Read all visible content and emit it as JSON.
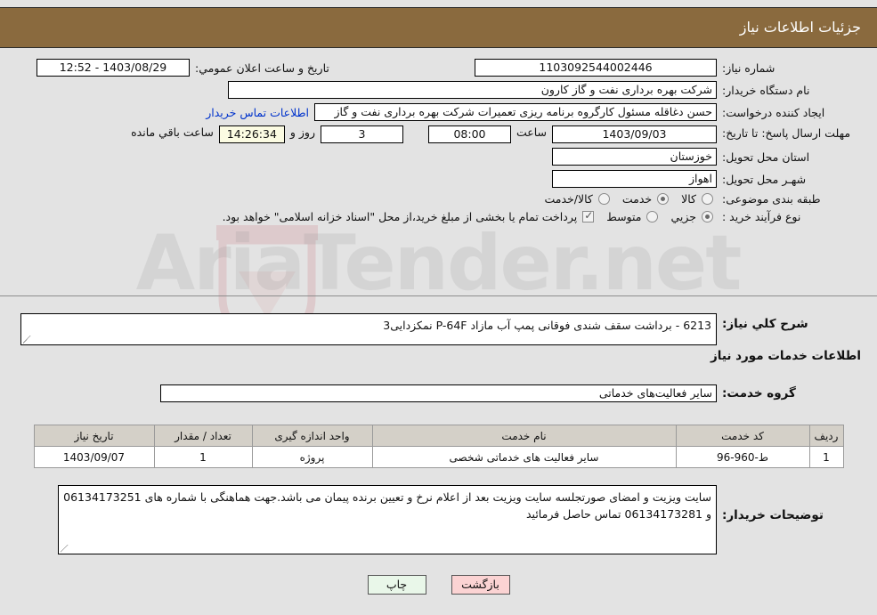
{
  "header": {
    "title": "جزئیات اطلاعات نیاز"
  },
  "form": {
    "need_number_label": "شماره نیاز:",
    "need_number_value": "1103092544002446",
    "announce_datetime_label": "تاریخ و ساعت اعلان عمومي:",
    "announce_datetime_value": "1403/08/29 - 12:52",
    "buyer_org_label": "نام دستگاه خریدار:",
    "buyer_org_value": "شرکت بهره برداری نفت و گاز کارون",
    "requester_label": "ایجاد کننده درخواست:",
    "requester_value": "حسن دغاقله مسئول کارگروه برنامه ریزی تعمیرات شرکت بهره برداری نفت و گاز",
    "contact_link": "اطلاعات تماس خریدار",
    "deadline_label": "مهلت ارسال پاسخ: تا تاریخ:",
    "deadline_date": "1403/09/03",
    "hour_label": "ساعت",
    "deadline_time": "08:00",
    "days_value": "3",
    "days_word": "روز و",
    "countdown_value": "14:26:34",
    "remaining_word": "ساعت باقي مانده",
    "province_label": "استان محل تحویل:",
    "province_value": "خوزستان",
    "city_label": "شهـر محل تحویل:",
    "city_value": "اهواز",
    "category_label": "طبقه بندی موضوعی:",
    "category_options": [
      {
        "label": "کالا",
        "selected": false
      },
      {
        "label": "خدمت",
        "selected": true
      },
      {
        "label": "کالا/خدمت",
        "selected": false
      }
    ],
    "process_label": "نوع فرآیند خرید :",
    "process_options": [
      {
        "label": "جزیي",
        "selected": true
      },
      {
        "label": "متوسط",
        "selected": false
      }
    ],
    "treasury_checked": true,
    "treasury_text": "پرداخت تمام یا بخشی از مبلغ خرید،از محل \"اسناد خزانه اسلامی\" خواهد بود."
  },
  "need_summary": {
    "label": "شرح کلي نیاز:",
    "value": "6213 - برداشت سقف شندی فوقانی پمپ آب مازاد P-64F نمکزدایی3"
  },
  "services_section": {
    "heading": "اطلاعات خدمات مورد نیاز",
    "group_label": "گروه خدمت:",
    "group_value": "سایر فعالیت‌های خدماتی"
  },
  "table": {
    "columns": [
      "ردیف",
      "کد خدمت",
      "نام خدمت",
      "واحد اندازه گیری",
      "تعداد / مقدار",
      "تاریخ نیاز"
    ],
    "rows": [
      [
        "1",
        "ط-960-96",
        "سایر فعالیت های خدماتی شخصی",
        "پروژه",
        "1",
        "1403/09/07"
      ]
    ]
  },
  "buyer_notes": {
    "label": "توضیحات خریدار:",
    "value": "سایت ویزیت و امضای صورتجلسه سایت ویزیت بعد از اعلام نرخ و تعیین برنده پیمان می باشد.جهت هماهنگی با شماره های  06134173251 و 06134173281 تماس حاصل فرمائید"
  },
  "buttons": {
    "print": "چاپ",
    "back": "بازگشت"
  },
  "watermark": {
    "text": "AriaTender.net"
  },
  "colors": {
    "header_bg": "#8a6a3e",
    "link": "#0033cc",
    "print_btn": "#e9f7e9",
    "back_btn": "#fbd3d3",
    "countdown_bg": "#fbfbe2"
  }
}
